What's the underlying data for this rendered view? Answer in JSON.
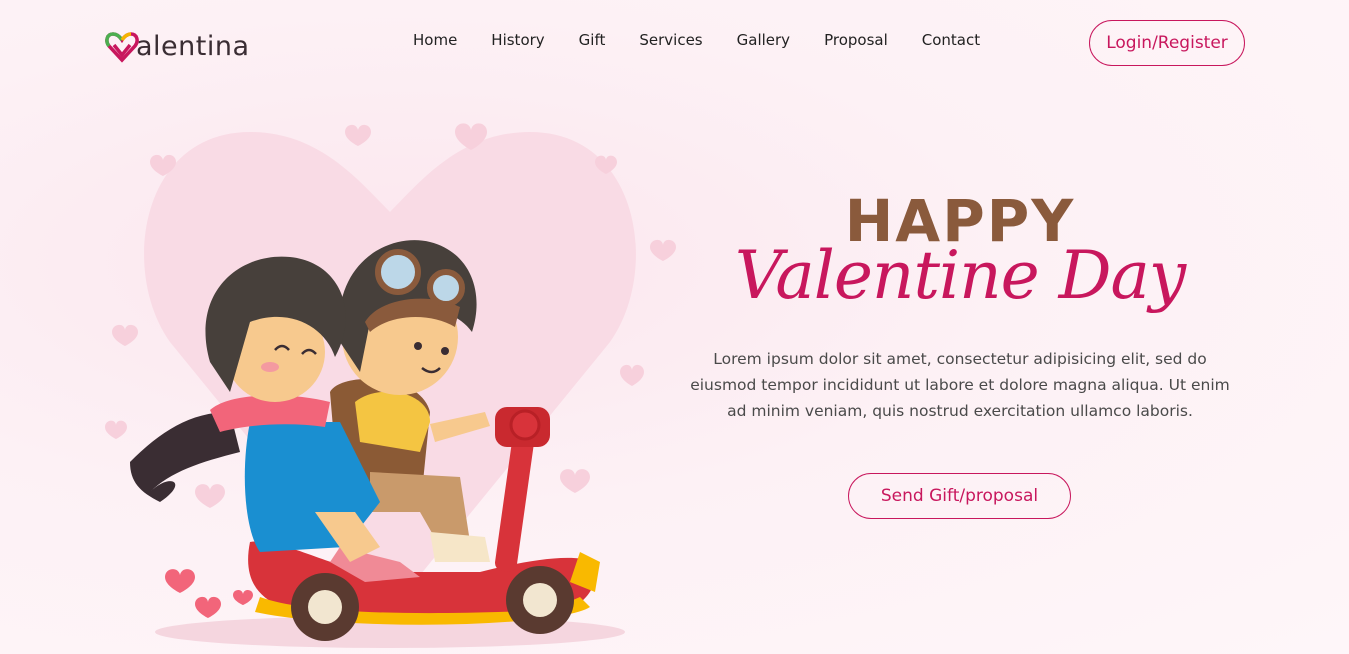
{
  "brand": {
    "logo_text": "alentina",
    "icon": "heart-logo-icon"
  },
  "nav": {
    "items": [
      {
        "label": "Home"
      },
      {
        "label": "History"
      },
      {
        "label": "Gift"
      },
      {
        "label": "Services"
      },
      {
        "label": "Gallery"
      },
      {
        "label": "Proposal"
      },
      {
        "label": "Contact"
      }
    ],
    "login_label": "Login/Register"
  },
  "hero": {
    "title_top": "HAPPY",
    "title_script": "Valentine Day",
    "description": "Lorem ipsum dolor sit amet, consectetur adipisicing elit, sed do eiusmod tempor incididunt ut labore et dolore magna aliqua. Ut enim ad minim veniam, quis nostrud exercitation ullamco laboris.",
    "cta_label": "Send Gift/proposal",
    "illustration": "couple-on-scooter-illustration"
  },
  "colors": {
    "accent": "#c8175d",
    "title_brown": "#8a5a3c",
    "background": "#fdf1f5"
  }
}
